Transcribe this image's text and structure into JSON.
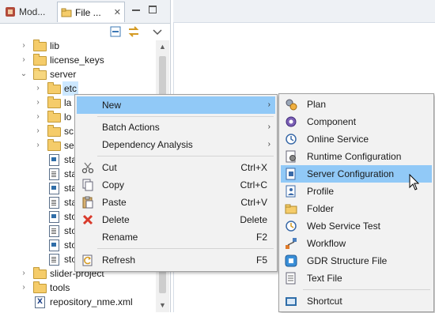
{
  "tabs": {
    "inactive_label": "Mod...",
    "active_label": "File ...",
    "close_glyph": "✕"
  },
  "tree": {
    "items": [
      {
        "label": "lib"
      },
      {
        "label": "license_keys"
      },
      {
        "label": "server"
      },
      {
        "label": "etc"
      },
      {
        "label": "la"
      },
      {
        "label": "lo"
      },
      {
        "label": "sc"
      },
      {
        "label": "se"
      },
      {
        "label": "sta"
      },
      {
        "label": "sta"
      },
      {
        "label": "sta"
      },
      {
        "label": "sta"
      },
      {
        "label": "sto"
      },
      {
        "label": "sto"
      },
      {
        "label": "sto"
      },
      {
        "label": "sto"
      },
      {
        "label": "slider-project"
      },
      {
        "label": "tools"
      },
      {
        "label": "repository_nme.xml"
      }
    ]
  },
  "context_menu": {
    "new": "New",
    "batch_actions": "Batch Actions",
    "dependency_analysis": "Dependency Analysis",
    "cut": "Cut",
    "cut_shortcut": "Ctrl+X",
    "copy": "Copy",
    "copy_shortcut": "Ctrl+C",
    "paste": "Paste",
    "paste_shortcut": "Ctrl+V",
    "delete": "Delete",
    "delete_shortcut": "Delete",
    "rename": "Rename",
    "rename_shortcut": "F2",
    "refresh": "Refresh",
    "refresh_shortcut": "F5",
    "submenu_arrow": "›"
  },
  "submenu": {
    "plan": "Plan",
    "component": "Component",
    "online_service": "Online Service",
    "runtime_configuration": "Runtime Configuration",
    "server_configuration": "Server Configuration",
    "profile": "Profile",
    "folder": "Folder",
    "web_service_test": "Web Service Test",
    "workflow": "Workflow",
    "gdr_structure_file": "GDR Structure File",
    "text_file": "Text File",
    "shortcut": "Shortcut"
  },
  "icons": {
    "accent_highlight": "#91c9f7",
    "selection": "#cde8ff",
    "folder_color": "#f5cc6a"
  }
}
